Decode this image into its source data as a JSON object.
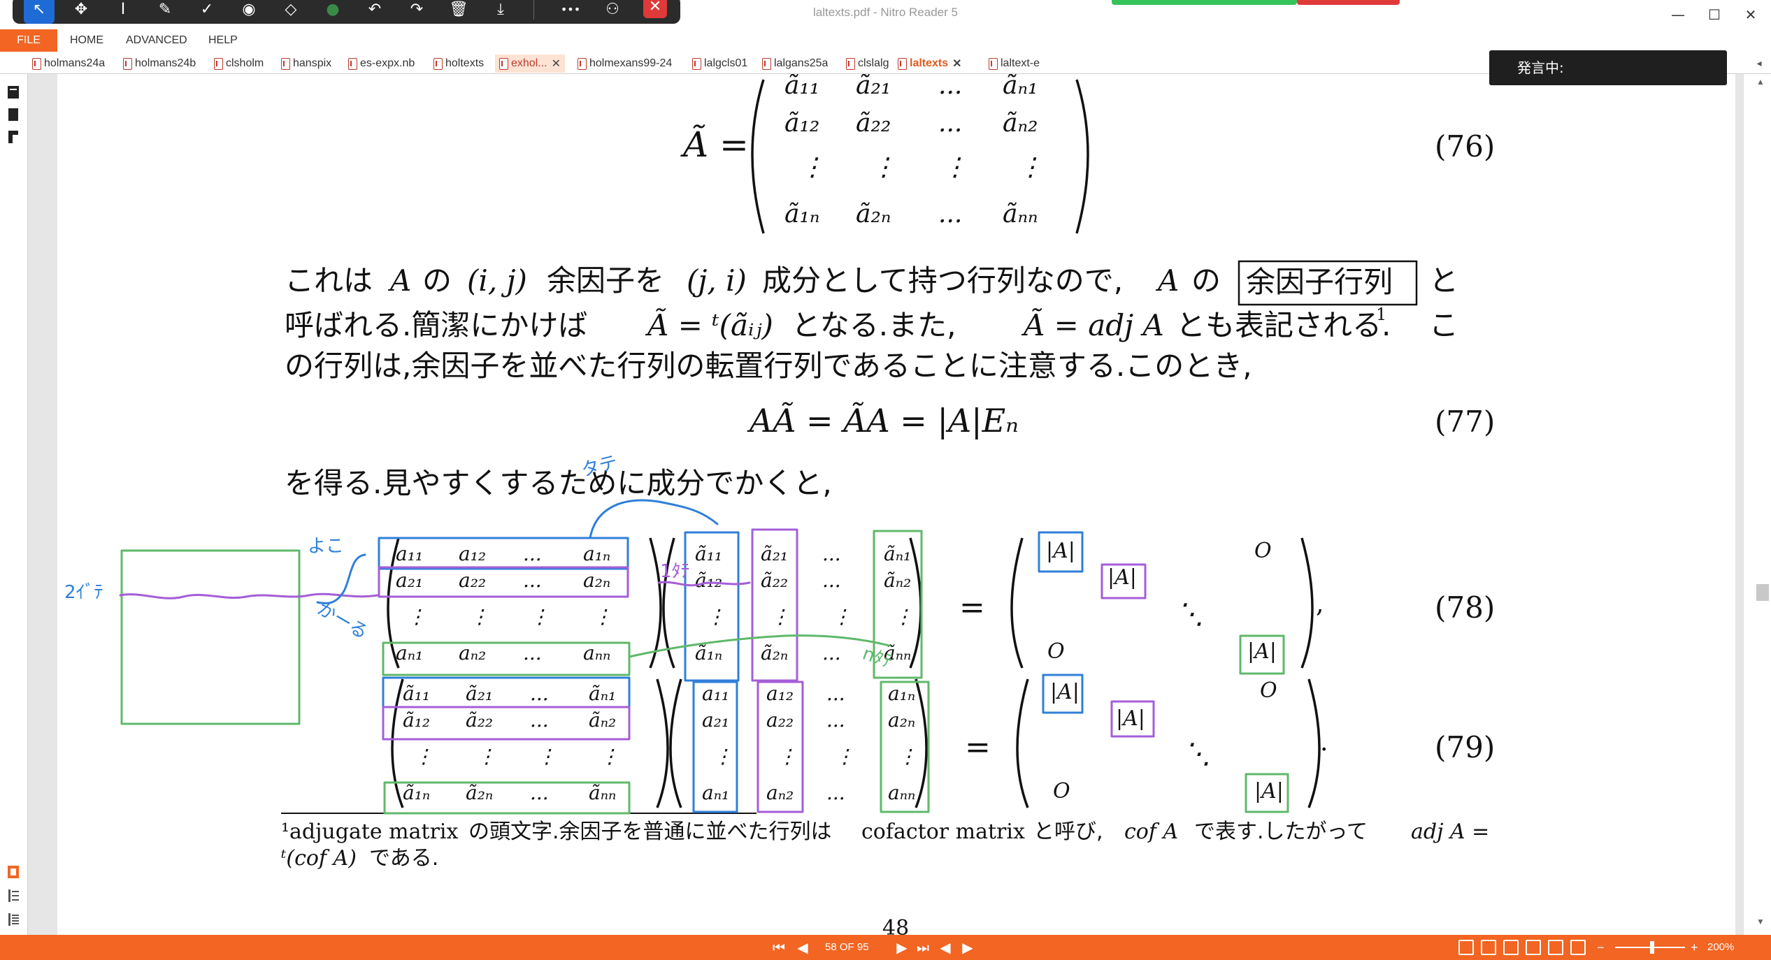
{
  "window": {
    "title": "laltexts.pdf - Nitro Reader 5",
    "minimize": "—",
    "maximize": "☐",
    "close": "✕"
  },
  "ink_toolbar": {
    "tools": [
      {
        "name": "pointer",
        "glyph": "↖"
      },
      {
        "name": "pan",
        "glyph": "✥"
      },
      {
        "name": "text-cursor",
        "glyph": "I"
      },
      {
        "name": "pen",
        "glyph": "✎"
      },
      {
        "name": "check",
        "glyph": "✓"
      },
      {
        "name": "stamp",
        "glyph": "◉"
      },
      {
        "name": "eraser",
        "glyph": "◇"
      },
      {
        "name": "color",
        "glyph": "●"
      },
      {
        "name": "undo",
        "glyph": "↶"
      },
      {
        "name": "redo",
        "glyph": "↷"
      },
      {
        "name": "delete",
        "glyph": "🗑"
      },
      {
        "name": "save",
        "glyph": "⤓"
      },
      {
        "name": "more",
        "glyph": "•••"
      },
      {
        "name": "share",
        "glyph": "⚇"
      },
      {
        "name": "close",
        "glyph": "✕"
      }
    ]
  },
  "menu": {
    "file": "FILE",
    "items": [
      "HOME",
      "ADVANCED",
      "HELP"
    ]
  },
  "tabs": [
    {
      "label": "holmans24a"
    },
    {
      "label": "holmans24b"
    },
    {
      "label": "clsholm"
    },
    {
      "label": "hanspix"
    },
    {
      "label": "es-expx.nb"
    },
    {
      "label": "holtexts"
    },
    {
      "label": "exhol...",
      "close": "✕"
    },
    {
      "label": "holmexans99-24"
    },
    {
      "label": "lalgcls01"
    },
    {
      "label": "lalgans25a"
    },
    {
      "label": "clslalg"
    },
    {
      "label": "laltexts",
      "close": "✕"
    },
    {
      "label": "laltext-e"
    }
  ],
  "speech_popup": "発言中:",
  "document": {
    "eq76_lhs": "Ã =",
    "eq76_num": "(76)",
    "eq77_num": "(77)",
    "eq78_num": "(78)",
    "eq79_num": "(79)",
    "eq77_formula": "AÃ = ÃA = |A|Eₙ",
    "para1_line1_a": "これは",
    "para1_line1_b": "A",
    "para1_line1_c": "の",
    "para1_line1_d": "(i, j)",
    "para1_line1_e": "余因子を",
    "para1_line1_f": "(j, i)",
    "para1_line1_g": "成分として持つ行列なので,",
    "para1_line1_h": "A",
    "para1_line1_i": "の",
    "boxed_term": "余因子行列",
    "para1_line1_j": "と",
    "para1_line2_a": "呼ばれる.簡潔にかけば",
    "para1_line2_b": "Ã = ᵗ(ãᵢⱼ)",
    "para1_line2_c": "となる.また,",
    "para1_line2_d": "Ã = adj A",
    "para1_line2_e": "とも表記される.",
    "para1_line2_fn": "1",
    "para1_line2_f": "こ",
    "para1_line3": "の行列は,余因子を並べた行列の転置行列であることに注意する.このとき,",
    "para2": "を得る.見やすくするために成分でかくと,",
    "footnote_line1_a": "¹adjugate matrix",
    "footnote_line1_b": "の頭文字.余因子を普通に並べた行列は",
    "footnote_line1_c": "cofactor matrix",
    "footnote_line1_d": "と呼び,",
    "footnote_line1_e": "cof A",
    "footnote_line1_f": "で表す.したがって",
    "footnote_line1_g": "adj A =",
    "footnote_line2_a": "ᵗ(cof A)",
    "footnote_line2_b": "である.",
    "page_number_partial": "48",
    "mat76": [
      [
        "ã₁₁",
        "ã₂₁",
        "...",
        "ãₙ₁"
      ],
      [
        "ã₁₂",
        "ã₂₂",
        "...",
        "ãₙ₂"
      ],
      [
        "⋮",
        "⋮",
        "⋮",
        "⋮"
      ],
      [
        "ã₁ₙ",
        "ã₂ₙ",
        "...",
        "ãₙₙ"
      ]
    ],
    "mat78_left": [
      [
        "a₁₁",
        "a₁₂",
        "...",
        "a₁ₙ"
      ],
      [
        "a₂₁",
        "a₂₂",
        "...",
        "a₂ₙ"
      ],
      [
        "⋮",
        "⋮",
        "⋮",
        "⋮"
      ],
      [
        "aₙ₁",
        "aₙ₂",
        "...",
        "aₙₙ"
      ]
    ],
    "mat78_right": [
      [
        "ã₁₁",
        "ã₂₁",
        "...",
        "ãₙ₁"
      ],
      [
        "ã₁₂",
        "ã₂₂",
        "...",
        "ãₙ₂"
      ],
      [
        "⋮",
        "⋮",
        "⋮",
        "⋮"
      ],
      [
        "ã₁ₙ",
        "ã₂ₙ",
        "...",
        "ãₙₙ"
      ]
    ],
    "mat79_left": [
      [
        "ã₁₁",
        "ã₂₁",
        "...",
        "ãₙ₁"
      ],
      [
        "ã₁₂",
        "ã₂₂",
        "...",
        "ãₙ₂"
      ],
      [
        "⋮",
        "⋮",
        "⋮",
        "⋮"
      ],
      [
        "ã₁ₙ",
        "ã₂ₙ",
        "...",
        "ãₙₙ"
      ]
    ],
    "mat79_right": [
      [
        "a₁₁",
        "a₁₂",
        "...",
        "a₁ₙ"
      ],
      [
        "a₂₁",
        "a₂₂",
        "...",
        "a₂ₙ"
      ],
      [
        "⋮",
        "⋮",
        "⋮",
        "⋮"
      ],
      [
        "aₙ₁",
        "aₙ₂",
        "...",
        "aₙₙ"
      ]
    ],
    "detA": "|A|",
    "zero_O": "O",
    "ddots": "⋱",
    "comma": ",",
    "period": ".",
    "equals": "="
  },
  "annotations": {
    "yoko": "よこ",
    "tate": "タテ",
    "kakeru": "かーる",
    "ni_tate": "2ｲﾞﾃ",
    "one_tate": "1ﾀﾃ",
    "n_tate": "nﾀﾃ"
  },
  "status": {
    "page_indicator": "58 OF 95",
    "zoom": "200%",
    "zoom_minus": "−",
    "zoom_plus": "+"
  },
  "colors": {
    "accent": "#f26522",
    "blue_ink": "#2f7fd9",
    "purple_ink": "#a45ed8",
    "green_ink": "#5fb86a"
  }
}
